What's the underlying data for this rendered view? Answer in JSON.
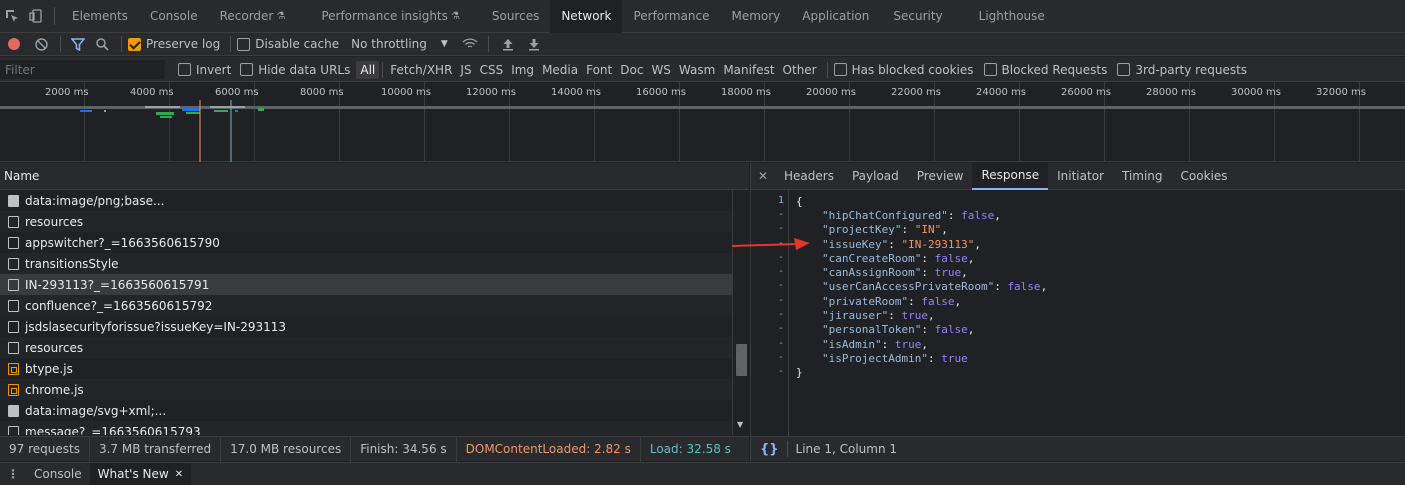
{
  "main_tabs": [
    "Elements",
    "Console",
    "Recorder",
    "Performance insights",
    "Sources",
    "Network",
    "Performance",
    "Memory",
    "Application",
    "Security",
    "Lighthouse"
  ],
  "toolbar": {
    "preserve_log": "Preserve log",
    "disable_cache": "Disable cache",
    "throttling": "No throttling"
  },
  "filter": {
    "placeholder": "Filter",
    "invert": "Invert",
    "hide_data_urls": "Hide data URLs",
    "types": [
      "All",
      "Fetch/XHR",
      "JS",
      "CSS",
      "Img",
      "Media",
      "Font",
      "Doc",
      "WS",
      "Wasm",
      "Manifest",
      "Other"
    ],
    "has_blocked_cookies": "Has blocked cookies",
    "blocked_requests": "Blocked Requests",
    "third_party": "3rd-party requests"
  },
  "overview": {
    "ticks": [
      "2000 ms",
      "4000 ms",
      "6000 ms",
      "8000 ms",
      "10000 ms",
      "12000 ms",
      "14000 ms",
      "16000 ms",
      "18000 ms",
      "20000 ms",
      "22000 ms",
      "24000 ms",
      "26000 ms",
      "28000 ms",
      "30000 ms",
      "32000 ms"
    ]
  },
  "list": {
    "header": "Name",
    "requests": [
      {
        "name": "data:image/png;base...",
        "icon": "image-file-icon"
      },
      {
        "name": "resources",
        "icon": "document-icon"
      },
      {
        "name": "appswitcher?_=1663560615790",
        "icon": "document-icon"
      },
      {
        "name": "transitionsStyle",
        "icon": "document-icon"
      },
      {
        "name": "IN-293113?_=1663560615791",
        "icon": "document-icon"
      },
      {
        "name": "confluence?_=1663560615792",
        "icon": "document-icon"
      },
      {
        "name": "jsdslasecurityforissue?issueKey=IN-293113",
        "icon": "document-icon"
      },
      {
        "name": "resources",
        "icon": "document-icon"
      },
      {
        "name": "btype.js",
        "icon": "script-icon"
      },
      {
        "name": "chrome.js",
        "icon": "script-icon"
      },
      {
        "name": "data:image/svg+xml;...",
        "icon": "image-file-icon"
      },
      {
        "name": "message?_=1663560615793",
        "icon": "document-icon"
      }
    ]
  },
  "status": {
    "requests": "97 requests",
    "transferred": "3.7 MB transferred",
    "resources": "17.0 MB resources",
    "finish": "Finish: 34.56 s",
    "dom_content_loaded": "DOMContentLoaded: 2.82 s",
    "load": "Load: 32.58 s"
  },
  "detail": {
    "tabs": [
      "Headers",
      "Payload",
      "Preview",
      "Response",
      "Initiator",
      "Timing",
      "Cookies"
    ],
    "first_line_number": "1",
    "gutter_marks": [
      "-",
      "-",
      "-",
      "-",
      "-",
      "-",
      "-",
      "-",
      "-",
      "-",
      "-",
      "-"
    ],
    "json_open": "{",
    "json_close": "}",
    "response_lines": [
      {
        "key": "\"hipChatConfigured\"",
        "value": "false",
        "type": "bool"
      },
      {
        "key": "\"projectKey\"",
        "value": "\"IN\"",
        "type": "string"
      },
      {
        "key": "\"issueKey\"",
        "value": "\"IN-293113\"",
        "type": "string"
      },
      {
        "key": "\"canCreateRoom\"",
        "value": "false",
        "type": "bool"
      },
      {
        "key": "\"canAssignRoom\"",
        "value": "true",
        "type": "bool"
      },
      {
        "key": "\"userCanAccessPrivateRoom\"",
        "value": "false",
        "type": "bool"
      },
      {
        "key": "\"privateRoom\"",
        "value": "false",
        "type": "bool"
      },
      {
        "key": "\"jirauser\"",
        "value": "true",
        "type": "bool"
      },
      {
        "key": "\"personalToken\"",
        "value": "false",
        "type": "bool"
      },
      {
        "key": "\"isAdmin\"",
        "value": "true",
        "type": "bool"
      },
      {
        "key": "\"isProjectAdmin\"",
        "value": "true",
        "type": "bool"
      }
    ],
    "cursor_position": "Line 1, Column 1",
    "pretty_print_glyph": "{}"
  },
  "drawer": {
    "tabs": [
      "Console",
      "What's New"
    ],
    "close_glyph": "✕"
  },
  "colors": {
    "accent_orange": "#f29900",
    "dcl_orange": "#f29766",
    "load_teal": "#56c4c4",
    "arrow_red": "#e8352a",
    "selected_tab_underline": "#8ab4f8"
  }
}
